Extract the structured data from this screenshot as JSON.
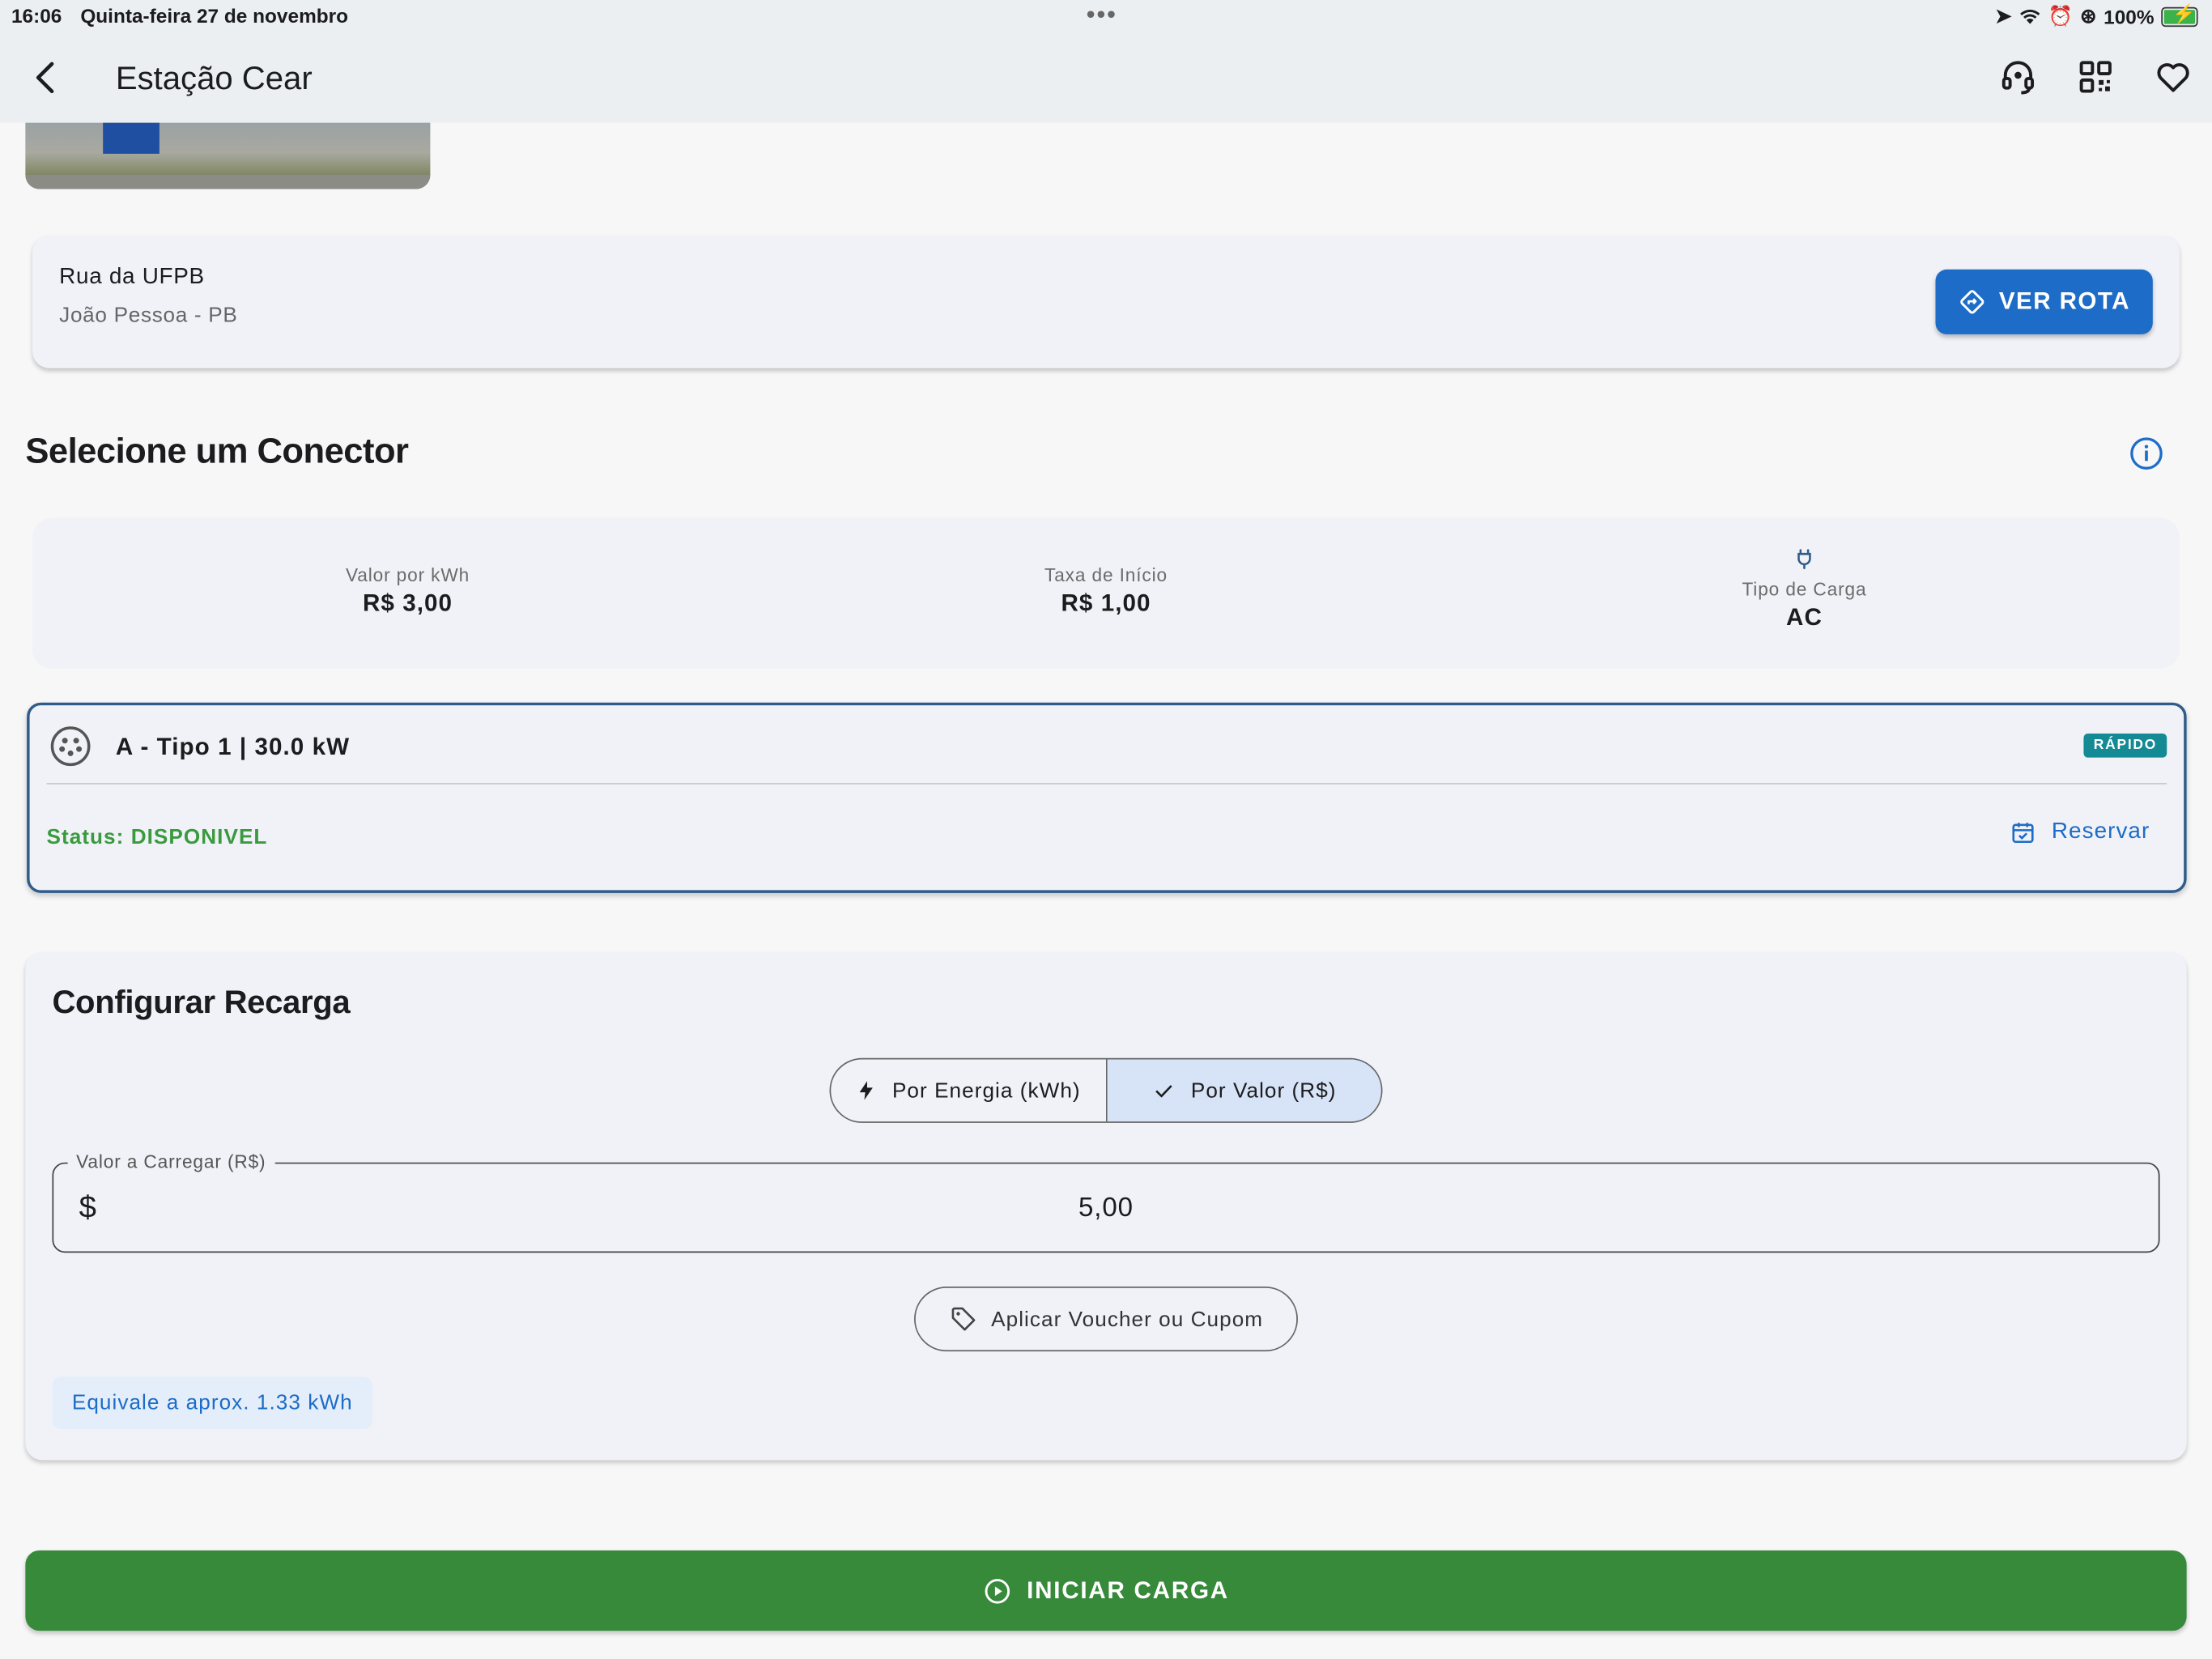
{
  "status_bar": {
    "time": "16:06",
    "date": "Quinta-feira 27 de novembro",
    "battery": "100%"
  },
  "app_bar": {
    "title": "Estação Cear"
  },
  "address": {
    "street": "Rua da UFPB",
    "city": "João Pessoa - PB",
    "route_label": "VER ROTA"
  },
  "connector_section": {
    "title": "Selecione um Conector"
  },
  "prices": {
    "kwh_label": "Valor por kWh",
    "kwh_value": "R$ 3,00",
    "start_fee_label": "Taxa de Início",
    "start_fee_value": "R$ 1,00",
    "charge_type_label": "Tipo de Carga",
    "charge_type_value": "AC"
  },
  "connector": {
    "name": "A - Tipo 1 | 30.0 kW",
    "badge": "RÁPIDO",
    "status": "Status: DISPONIVEL",
    "reserve_label": "Reservar"
  },
  "config": {
    "title": "Configurar Recarga",
    "mode_energy": "Por Energia (kWh)",
    "mode_value": "Por Valor (R$)",
    "selected_mode": "Por Valor (R$)",
    "amount_label": "Valor a Carregar (R$)",
    "amount_prefix": "$",
    "amount_value": "5,00",
    "voucher_label": "Aplicar Voucher ou Cupom",
    "equivalence": "Equivale a aprox. 1.33 kWh"
  },
  "start_button": {
    "label": "INICIAR CARGA"
  },
  "colors": {
    "primary_blue": "#1d6cc7",
    "success_green": "#378a3a",
    "status_green": "#3a9a3e",
    "badge_teal": "#138a94",
    "card_bg": "#f0f2f8",
    "selected_segment": "#d7e3f6"
  },
  "icons": {
    "back": "chevron-left-icon",
    "support": "headset-icon",
    "qr": "qr-code-icon",
    "favorite": "heart-icon",
    "route": "directions-icon",
    "info": "info-icon",
    "plug": "plug-icon",
    "connector": "ev-connector-icon",
    "calendar": "calendar-check-icon",
    "bolt": "bolt-icon",
    "check": "check-icon",
    "tag": "tag-icon",
    "play": "play-circle-icon"
  }
}
